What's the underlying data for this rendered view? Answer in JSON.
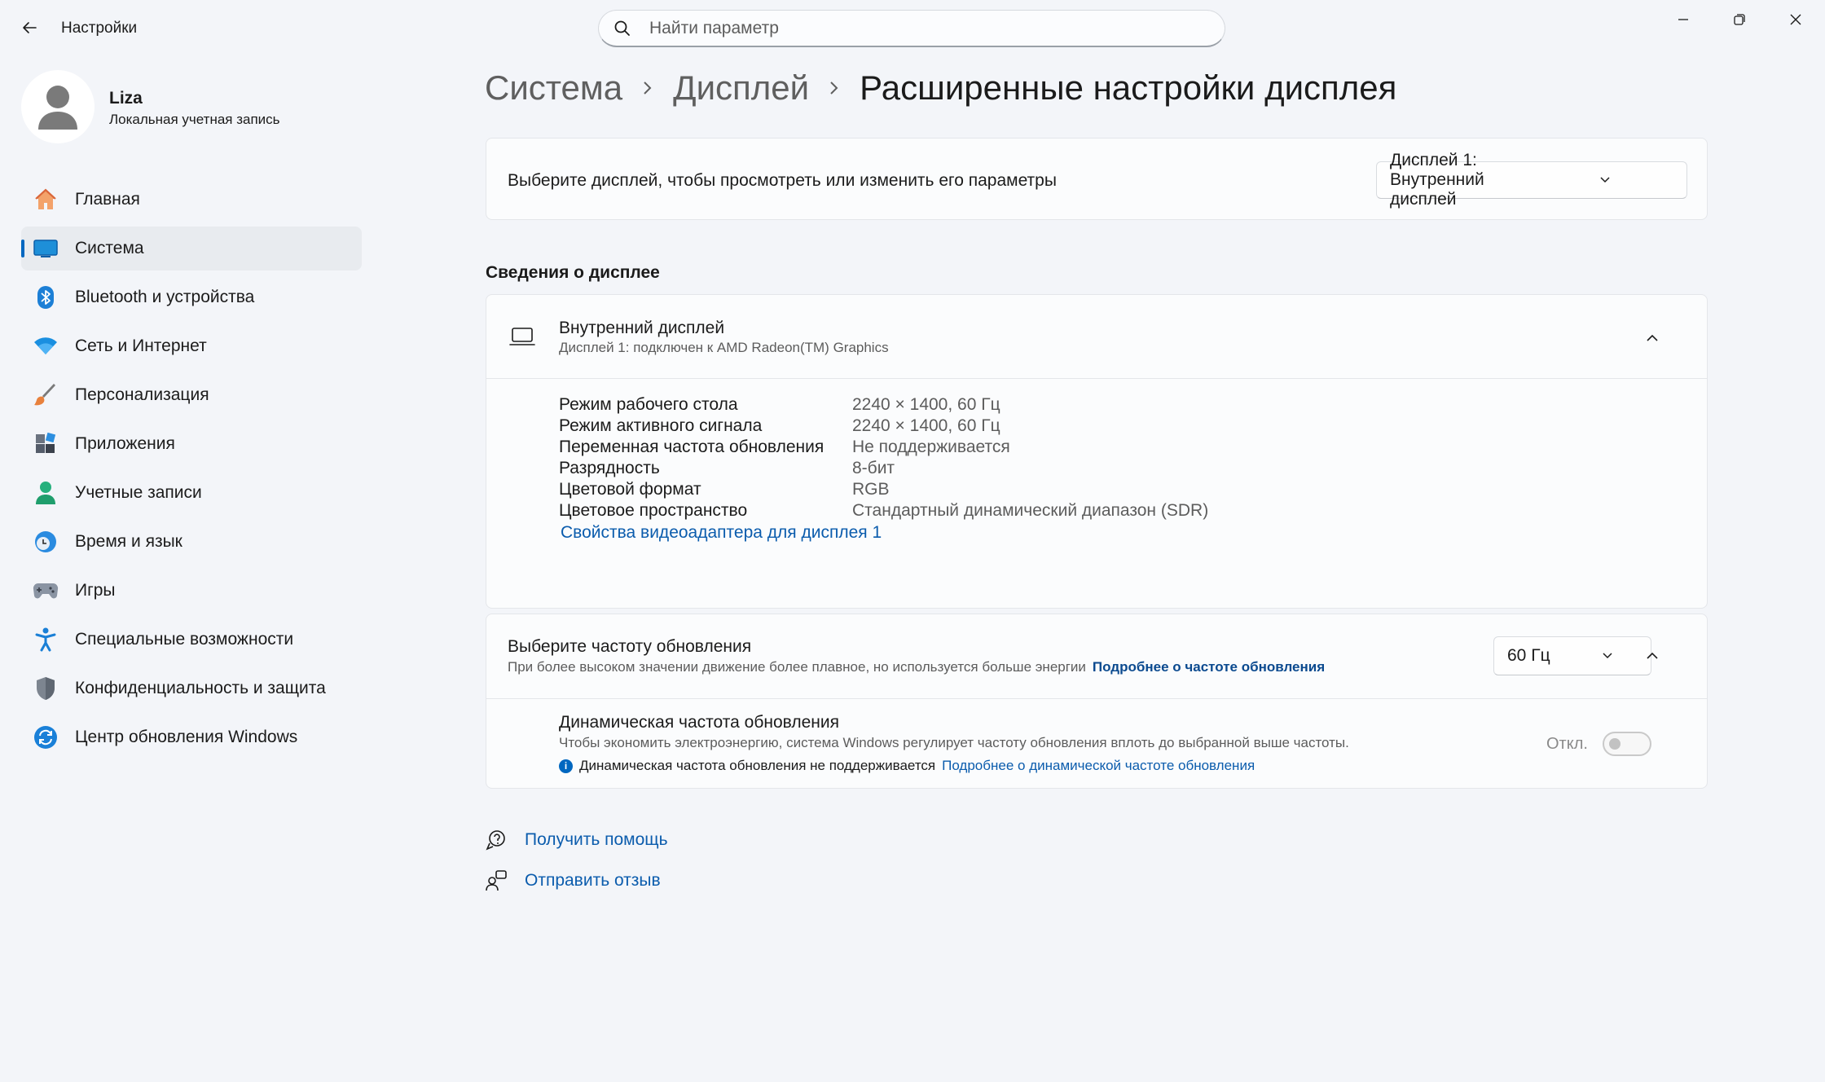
{
  "window": {
    "title": "Настройки"
  },
  "search": {
    "placeholder": "Найти параметр"
  },
  "user": {
    "name": "Liza",
    "account_type": "Локальная учетная запись"
  },
  "sidebar": {
    "items": [
      {
        "label": "Главная",
        "icon": "home-icon"
      },
      {
        "label": "Система",
        "icon": "system-display-icon",
        "active": true
      },
      {
        "label": "Bluetooth и устройства",
        "icon": "bluetooth-icon"
      },
      {
        "label": "Сеть и Интернет",
        "icon": "wifi-icon"
      },
      {
        "label": "Персонализация",
        "icon": "brush-icon"
      },
      {
        "label": "Приложения",
        "icon": "apps-icon"
      },
      {
        "label": "Учетные записи",
        "icon": "person-icon"
      },
      {
        "label": "Время и язык",
        "icon": "clock-globe-icon"
      },
      {
        "label": "Игры",
        "icon": "gamepad-icon"
      },
      {
        "label": "Специальные возможности",
        "icon": "accessibility-icon"
      },
      {
        "label": "Конфиденциальность и защита",
        "icon": "shield-icon"
      },
      {
        "label": "Центр обновления Windows",
        "icon": "update-icon"
      }
    ]
  },
  "breadcrumb": {
    "items": [
      "Система",
      "Дисплей"
    ],
    "current": "Расширенные настройки дисплея"
  },
  "display_select": {
    "label": "Выберите дисплей, чтобы просмотреть или изменить его параметры",
    "selected": "Дисплей 1: Внутренний дисплей"
  },
  "display_info": {
    "section_title": "Сведения о дисплее",
    "title": "Внутренний дисплей",
    "subtitle": "Дисплей 1: подключен к AMD Radeon(TM) Graphics",
    "rows": [
      {
        "label": "Режим рабочего стола",
        "value": "2240 × 1400, 60 Гц"
      },
      {
        "label": "Режим активного сигнала",
        "value": "2240 × 1400, 60 Гц"
      },
      {
        "label": "Переменная частота обновления",
        "value": "Не поддерживается"
      },
      {
        "label": "Разрядность",
        "value": "8-бит"
      },
      {
        "label": "Цветовой формат",
        "value": "RGB"
      },
      {
        "label": "Цветовое пространство",
        "value": "Стандартный динамический диапазон (SDR)"
      }
    ],
    "adapter_link": "Свойства видеоадаптера для дисплея 1"
  },
  "refresh": {
    "title": "Выберите частоту обновления",
    "subtitle": "При более высоком значении движение более плавное, но используется больше энергии",
    "learn_more": "Подробнее о частоте обновления",
    "selected": "60 Гц",
    "dynamic": {
      "title": "Динамическая частота обновления",
      "subtitle": "Чтобы экономить электроэнергию, система Windows регулирует частоту обновления вплоть до выбранной выше частоты.",
      "not_supported": "Динамическая частота обновления не поддерживается",
      "learn_more": "Подробнее о динамической частоте обновления",
      "toggle_label": "Откл."
    }
  },
  "footer": {
    "help": "Получить помощь",
    "feedback": "Отправить отзыв"
  },
  "colors": {
    "accent": "#0067c0",
    "link": "#0b5cad",
    "background": "#f3f5f9"
  }
}
